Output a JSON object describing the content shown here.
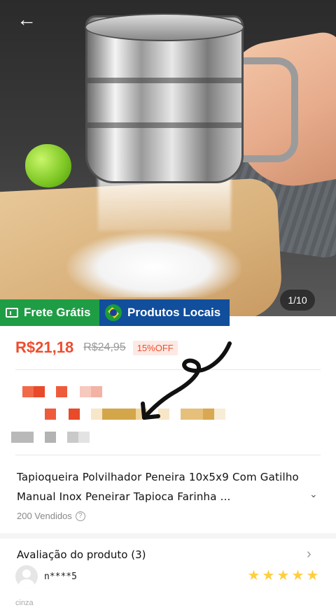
{
  "hero": {
    "image_counter": "1/10",
    "back_icon": "arrow-left-icon"
  },
  "badges": {
    "free_shipping": "Frete Grátis",
    "local_products": "Produtos Locais"
  },
  "price": {
    "current": "R$21,18",
    "original": "R$24,95",
    "discount": "15%OFF"
  },
  "product": {
    "title": "Tapioqueira Polvilhador Peneira 10x5x9 Com Gatilho Manual Inox Peneirar Tapioca Farinha ...",
    "sold": "200 Vendidos"
  },
  "reviews": {
    "heading": "Avaliação do produto (3)",
    "reviewer": "n****5",
    "rating": 5,
    "variant": "cinza"
  },
  "colors": {
    "accent": "#ee4d2d",
    "free_shipping_bg": "#1f9d45",
    "local_bg": "#114e9c",
    "star": "#ffce3d"
  }
}
